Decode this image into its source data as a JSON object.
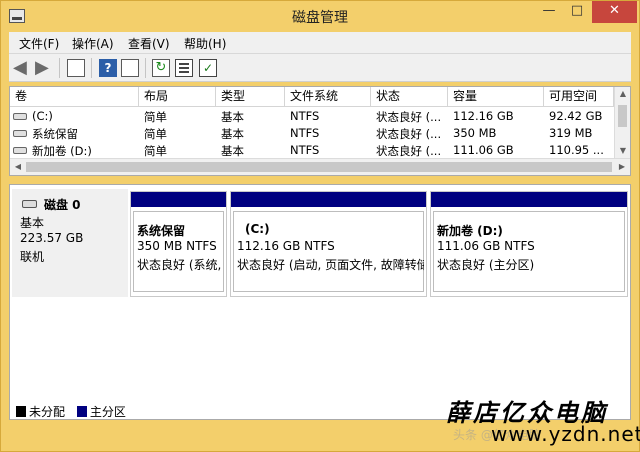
{
  "window": {
    "title": "磁盘管理"
  },
  "title_buttons": {
    "minimize": "—",
    "maximize": "□",
    "close": "✕"
  },
  "menu": [
    {
      "label": "文件(F)"
    },
    {
      "label": "操作(A)"
    },
    {
      "label": "查看(V)"
    },
    {
      "label": "帮助(H)"
    }
  ],
  "toolbar": {
    "icons": [
      "back-arrow-icon",
      "forward-arrow-icon",
      "console-tree-icon",
      "help-icon",
      "show-pane-icon",
      "refresh-icon",
      "properties-icon",
      "check-icon"
    ]
  },
  "volume_table": {
    "headers": [
      "卷",
      "布局",
      "类型",
      "文件系统",
      "状态",
      "容量",
      "可用空间"
    ],
    "rows": [
      {
        "volume": "(C:)",
        "layout": "简单",
        "type": "基本",
        "fs": "NTFS",
        "status": "状态良好 (...",
        "capacity": "112.16 GB",
        "free": "92.42 GB"
      },
      {
        "volume": "系统保留",
        "layout": "简单",
        "type": "基本",
        "fs": "NTFS",
        "status": "状态良好 (...",
        "capacity": "350 MB",
        "free": "319 MB"
      },
      {
        "volume": "新加卷 (D:)",
        "layout": "简单",
        "type": "基本",
        "fs": "NTFS",
        "status": "状态良好 (...",
        "capacity": "111.06 GB",
        "free": "110.95 ..."
      }
    ]
  },
  "disk": {
    "name": "磁盘 0",
    "type": "基本",
    "size": "223.57 GB",
    "state": "联机"
  },
  "partitions": [
    {
      "name": "系统保留",
      "size": "350 MB NTFS",
      "status": "状态良好 (系统,"
    },
    {
      "name": "(C:)",
      "size": "112.16 GB NTFS",
      "status": "状态良好 (启动, 页面文件, 故障转储"
    },
    {
      "name": "新加卷  (D:)",
      "size": "111.06 GB NTFS",
      "status": "状态良好 (主分区)"
    }
  ],
  "legend": [
    {
      "label": "未分配",
      "color": "#000000"
    },
    {
      "label": "主分区",
      "color": "#000080"
    }
  ],
  "watermark": {
    "brand": "薛店亿众电脑",
    "url": "www.yzdn.net",
    "faint": "头条 @亿众电脑"
  },
  "colors": {
    "partition_bar": "#000080",
    "title_bg": "#f3cf6b",
    "close_btn": "#c7463d"
  }
}
